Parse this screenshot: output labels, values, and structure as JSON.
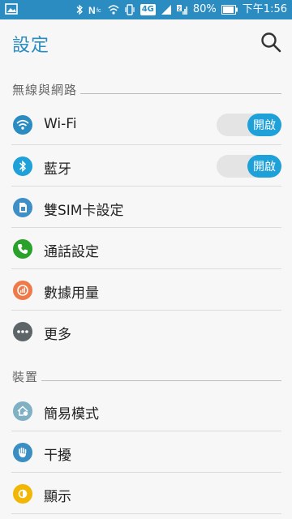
{
  "status_bar": {
    "battery": "80%",
    "time": "下午1:56",
    "network": "4G"
  },
  "app_bar": {
    "title": "設定"
  },
  "sections": {
    "network": {
      "title": "無線與網路",
      "wifi": {
        "label": "Wi-Fi",
        "toggle": "開啟"
      },
      "bluetooth": {
        "label": "藍牙",
        "toggle": "開啟"
      },
      "dual_sim": {
        "label": "雙SIM卡設定"
      },
      "call": {
        "label": "通話設定"
      },
      "data_usage": {
        "label": "數據用量"
      },
      "more": {
        "label": "更多"
      }
    },
    "device": {
      "title": "裝置",
      "easy_mode": {
        "label": "簡易模式"
      },
      "do_not_disturb": {
        "label": "干擾"
      },
      "display": {
        "label": "顯示"
      }
    }
  },
  "colors": {
    "status_bar": "#2a8cc0",
    "accent": "#1ea0d8",
    "wifi_icon": "#2a8cc0",
    "bluetooth_icon": "#1ea0d8",
    "dual_sim_icon": "#3f8fc7",
    "call_icon": "#2aa12a",
    "data_usage_icon": "#ee7a4a",
    "more_icon": "#5d6569",
    "easy_mode_icon": "#7fb0c4",
    "dnd_icon": "#3a8ec2",
    "display_icon": "#f2b705"
  },
  "icons": {
    "status_left": "image-icon",
    "wifi": "wifi-icon",
    "bluetooth": "bluetooth-icon",
    "dual_sim": "sim-card-icon",
    "call": "phone-icon",
    "data_usage": "data-usage-icon",
    "more": "more-dots-icon",
    "easy_mode": "house-icon",
    "do_not_disturb": "hand-icon",
    "display": "brightness-icon",
    "search": "search-icon"
  }
}
